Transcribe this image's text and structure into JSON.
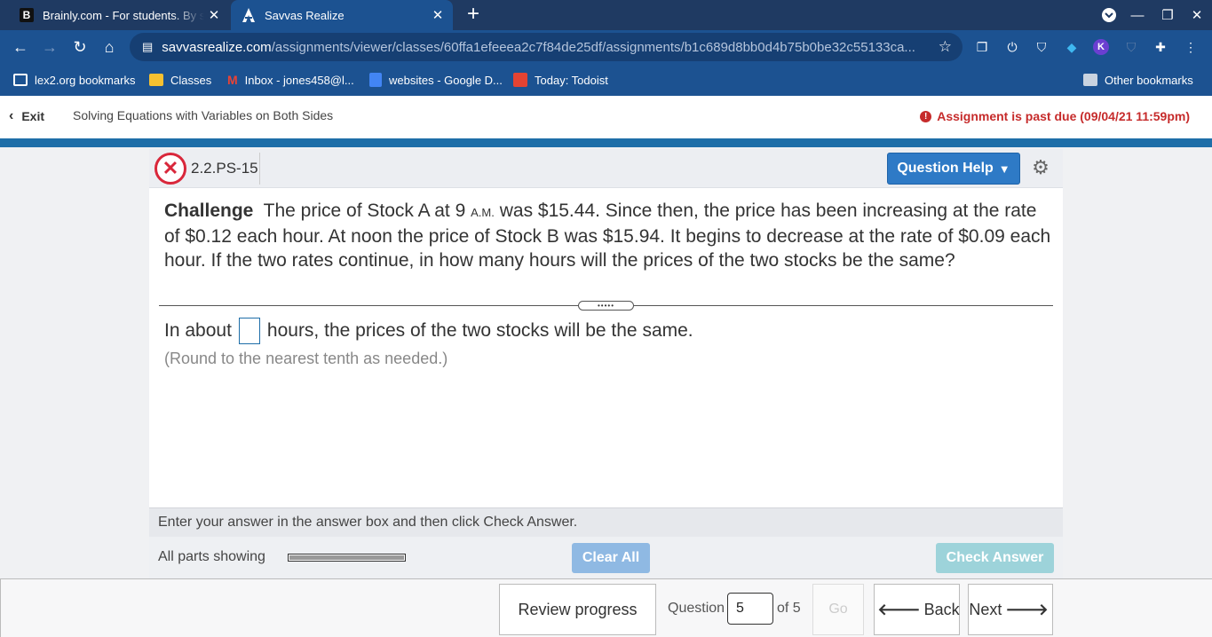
{
  "browser": {
    "tabs": [
      {
        "title": "Brainly.com - For students. By students",
        "favicon": "B",
        "active": false
      },
      {
        "title": "Savvas Realize",
        "active": true
      }
    ],
    "url_host": "savvasrealize.com",
    "url_path": "/assignments/viewer/classes/60ffa1efeeea2c7f84de25df/assignments/b1c689d8bb0d4b75b0be32c55133ca...",
    "bookmarks": [
      {
        "label": "lex2.org bookmarks"
      },
      {
        "label": "Classes"
      },
      {
        "label": "Inbox - jones458@l..."
      },
      {
        "label": "websites - Google D..."
      },
      {
        "label": "Today: Todoist"
      },
      {
        "label": "Other bookmarks"
      }
    ],
    "colors": {
      "tabbar": "#1f3a62",
      "toolbar": "#1c5291"
    }
  },
  "header": {
    "exit_label": "Exit",
    "title": "Solving Equations with Variables on Both Sides",
    "past_due": "Assignment is past due (09/04/21 11:59pm)"
  },
  "question": {
    "id": "2.2.PS-15",
    "help_label": "Question Help",
    "challenge_label": "Challenge",
    "text_part1": "The price of Stock A at 9",
    "am_label": "A.M.",
    "text_part2": "was $15.44. Since then, the price has been increasing at the rate of $0.12 each hour. At noon the price of Stock B was $15.94. It begins to decrease at the rate of $0.09 each hour. If the two rates continue, in how many hours will the prices of the two stocks be the same?",
    "answer_prefix": "In about",
    "answer_suffix": "hours, the prices of the two stocks will be the same.",
    "answer_value": "",
    "round_note": "(Round to the nearest tenth as needed.)"
  },
  "status": {
    "instruction": "Enter your answer in the answer box and then click Check Answer.",
    "parts_label": "All parts showing",
    "clear_all_label": "Clear All",
    "check_answer_label": "Check Answer",
    "progress_fraction": 1.0
  },
  "footer": {
    "review_label": "Review progress",
    "question_label": "Question",
    "question_value": "5",
    "of_label": "of 5",
    "go_label": "Go",
    "back_label": "Back",
    "next_label": "Next"
  }
}
